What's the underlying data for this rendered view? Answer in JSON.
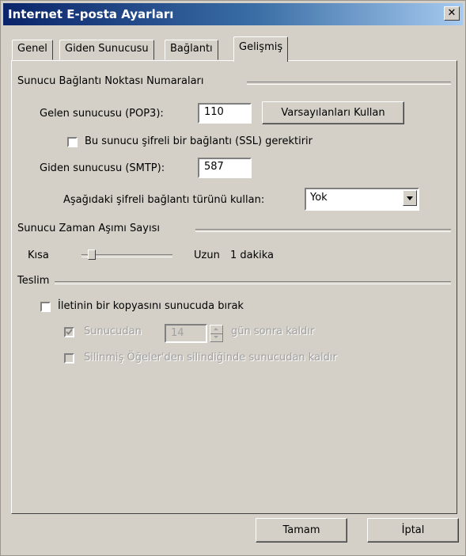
{
  "window": {
    "title": "Internet E-posta Ayarları",
    "close_glyph": "✕"
  },
  "tabs": [
    {
      "label": "Genel"
    },
    {
      "label": "Giden Sunucusu"
    },
    {
      "label": "Bağlantı"
    },
    {
      "label": "Gelişmiş",
      "active": true
    }
  ],
  "ports": {
    "group_label": "Sunucu Bağlantı Noktası Numaraları",
    "pop3_label": "Gelen sunucusu (POP3):",
    "pop3_value": "110",
    "defaults_button": "Varsayılanları Kullan",
    "ssl_label": "Bu sunucu şifreli bir bağlantı (SSL) gerektirir",
    "ssl_checked": false,
    "smtp_label": "Giden sunucusu (SMTP):",
    "smtp_value": "587",
    "encryption_label": "Aşağıdaki şifreli bağlantı türünü kullan:",
    "encryption_value": "Yok"
  },
  "timeout": {
    "group_label": "Sunucu Zaman Aşımı Sayısı",
    "short_label": "Kısa",
    "long_label": "Uzun",
    "value_text": "1 dakika",
    "level": 0.0
  },
  "delivery": {
    "group_label": "Teslim",
    "leave_copy_label": "İletinin bir kopyasını sunucuda bırak",
    "leave_copy_checked": false,
    "remove_after_label": "Sunucudan",
    "remove_after_checked": true,
    "days_value": "14",
    "days_suffix": "gün sonra kaldır",
    "remove_deleted_label": "Silinmiş Öğeler'den silindiğinde sunucudan kaldır",
    "remove_deleted_checked": false
  },
  "footer": {
    "ok_label": "Tamam",
    "cancel_label": "İptal"
  }
}
